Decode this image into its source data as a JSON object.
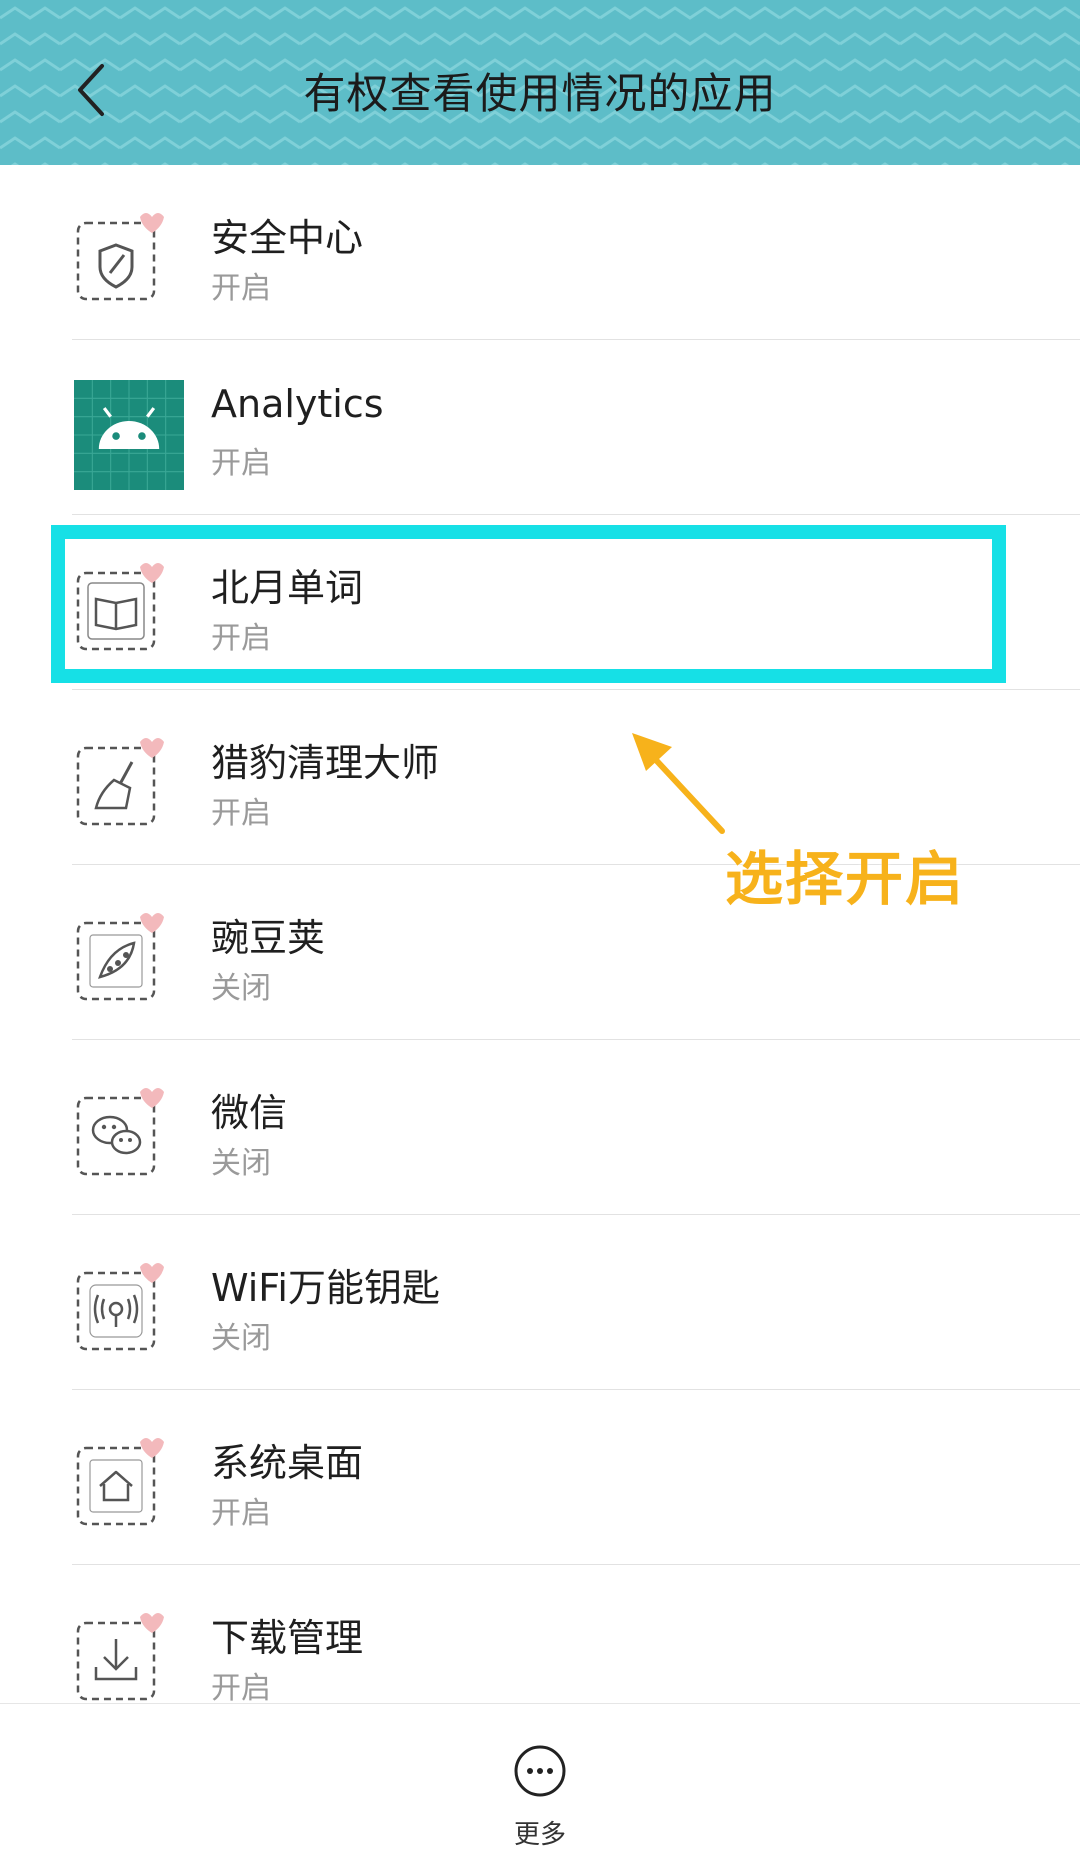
{
  "header": {
    "title": "有权查看使用情况的应用",
    "background_color": "#5dbdc8",
    "back_icon": "chevron-left-icon"
  },
  "apps": [
    {
      "name": "安全中心",
      "status": "开启",
      "icon": "shield-icon"
    },
    {
      "name": "Analytics",
      "status": "开启",
      "icon": "android-icon"
    },
    {
      "name": "北月单词",
      "status": "开启",
      "icon": "book-icon"
    },
    {
      "name": "猎豹清理大师",
      "status": "开启",
      "icon": "broom-icon"
    },
    {
      "name": "豌豆荚",
      "status": "关闭",
      "icon": "pea-pod-icon"
    },
    {
      "name": "微信",
      "status": "关闭",
      "icon": "wechat-icon"
    },
    {
      "name": "WiFi万能钥匙",
      "status": "关闭",
      "icon": "wifi-key-icon"
    },
    {
      "name": "系统桌面",
      "status": "开启",
      "icon": "home-icon"
    },
    {
      "name": "下载管理",
      "status": "开启",
      "icon": "download-icon"
    }
  ],
  "annotation": {
    "text": "选择开启",
    "color": "#f7b21b",
    "highlight_color": "#16e0e6"
  },
  "bottom_bar": {
    "more_label": "更多",
    "more_icon": "more-dots-icon"
  }
}
